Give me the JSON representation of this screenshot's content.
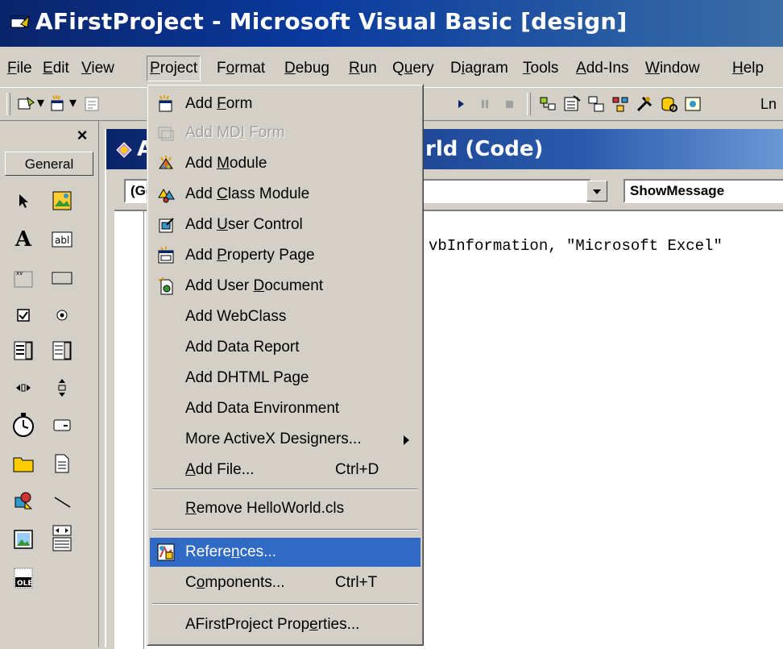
{
  "window": {
    "title": "AFirstProject - Microsoft Visual Basic [design]"
  },
  "menubar": [
    {
      "label": "File",
      "underline": "F",
      "rest": "ile"
    },
    {
      "label": "Edit",
      "underline": "E",
      "rest": "dit"
    },
    {
      "label": "View",
      "underline": "V",
      "rest": "iew"
    },
    {
      "label": "Project",
      "underline": "P",
      "rest": "roject"
    },
    {
      "label": "Format",
      "pre": "F",
      "underline": "o",
      "rest": "rmat"
    },
    {
      "label": "Debug",
      "underline": "D",
      "rest": "ebug"
    },
    {
      "label": "Run",
      "underline": "R",
      "rest": "un"
    },
    {
      "label": "Query",
      "pre": "Q",
      "underline": "u",
      "rest": "ery"
    },
    {
      "label": "Diagram",
      "pre": "D",
      "underline": "i",
      "rest": "agram"
    },
    {
      "label": "Tools",
      "underline": "T",
      "rest": "ools"
    },
    {
      "label": "Add-Ins",
      "underline": "A",
      "rest": "dd-Ins"
    },
    {
      "label": "Window",
      "underline": "W",
      "rest": "indow"
    },
    {
      "label": "Help",
      "underline": "H",
      "rest": "elp"
    }
  ],
  "toolbar": {
    "position_text": "Ln"
  },
  "toolbox": {
    "close": "×",
    "tab_label": "General"
  },
  "code_window": {
    "title": "HelloWorld (Code)",
    "title_prefix": "A",
    "title_suffix": "rld (Code)",
    "object_combo": "(Ge",
    "proc_combo": "ShowMessage",
    "code_line": "vbInformation, \"Microsoft Excel\""
  },
  "project_menu": {
    "items": [
      {
        "label": "Add Form",
        "pre": "Add ",
        "u": "F",
        "post": "orm",
        "icon": "add-form-icon",
        "enabled": true
      },
      {
        "label": "Add MDI Form",
        "pre": "Add MD",
        "u": "I",
        "post": " Form",
        "icon": "add-mdi-form-icon",
        "enabled": false
      },
      {
        "label": "Add Module",
        "pre": "Add ",
        "u": "M",
        "post": "odule",
        "icon": "add-module-icon",
        "enabled": true
      },
      {
        "label": "Add Class Module",
        "pre": "Add ",
        "u": "C",
        "post": "lass Module",
        "icon": "add-class-module-icon",
        "enabled": true
      },
      {
        "label": "Add User Control",
        "pre": "Add ",
        "u": "U",
        "post": "ser Control",
        "icon": "add-user-control-icon",
        "enabled": true
      },
      {
        "label": "Add Property Page",
        "pre": "Add ",
        "u": "P",
        "post": "roperty Page",
        "icon": "add-property-page-icon",
        "enabled": true
      },
      {
        "label": "Add User Document",
        "pre": "Add User ",
        "u": "D",
        "post": "ocument",
        "icon": "add-user-document-icon",
        "enabled": true
      },
      {
        "label": "Add WebClass",
        "enabled": true
      },
      {
        "label": "Add Data Report",
        "enabled": true
      },
      {
        "label": "Add DHTML Page",
        "enabled": true
      },
      {
        "label": "Add Data Environment",
        "enabled": true
      },
      {
        "label": "More ActiveX Designers...",
        "pre": "More ActiveX Desi",
        "u": "g",
        "post": "ners...",
        "submenu": true,
        "enabled": true
      },
      {
        "label": "Add File...",
        "pre": "",
        "u": "A",
        "post": "dd File...",
        "shortcut": "Ctrl+D",
        "enabled": true
      },
      {
        "label": "Remove HelloWorld.cls",
        "pre": "",
        "u": "R",
        "post": "emove HelloWorld.cls",
        "enabled": true
      },
      {
        "label": "References...",
        "pre": "Refere",
        "u": "n",
        "post": "ces...",
        "icon": "references-icon",
        "enabled": true,
        "selected": true
      },
      {
        "label": "Components...",
        "pre": "C",
        "u": "o",
        "post": "mponents...",
        "shortcut": "Ctrl+T",
        "enabled": true
      },
      {
        "label": "AFirstProject Properties...",
        "pre": "AFirstProject Prop",
        "u": "e",
        "post": "rties...",
        "enabled": true
      }
    ]
  }
}
